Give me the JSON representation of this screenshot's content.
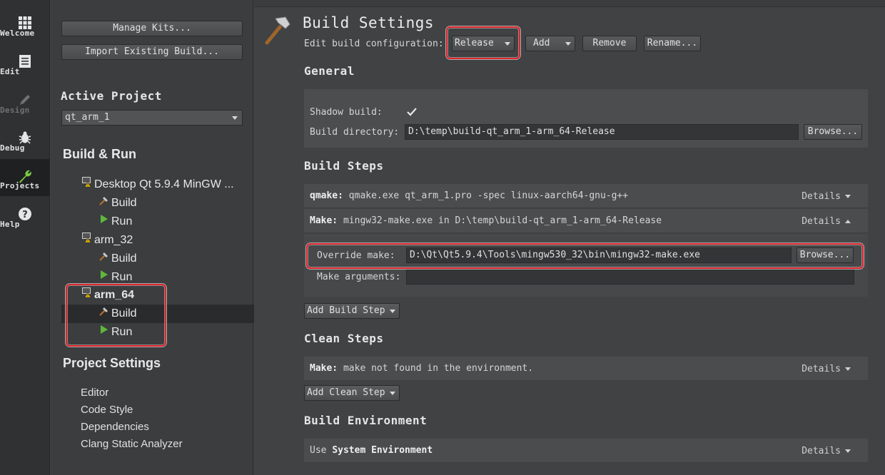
{
  "modebar": {
    "items": [
      {
        "label": "Welcome",
        "icon": "grid-icon"
      },
      {
        "label": "Edit",
        "icon": "document-icon"
      },
      {
        "label": "Design",
        "icon": "pencil-icon"
      },
      {
        "label": "Debug",
        "icon": "bug-icon"
      },
      {
        "label": "Projects",
        "icon": "wrench-icon"
      },
      {
        "label": "Help",
        "icon": "help-icon"
      }
    ]
  },
  "sidebar": {
    "manage_kits": "Manage Kits...",
    "import_build": "Import Existing Build...",
    "active_project_title": "Active Project",
    "active_project_value": "qt_arm_1",
    "build_run_title": "Build & Run",
    "kits": [
      {
        "name": "Desktop Qt 5.9.4 MinGW ...",
        "build": "Build",
        "run": "Run"
      },
      {
        "name": "arm_32",
        "build": "Build",
        "run": "Run"
      },
      {
        "name": "arm_64",
        "build": "Build",
        "run": "Run"
      }
    ],
    "project_settings_title": "Project Settings",
    "project_settings": [
      "Editor",
      "Code Style",
      "Dependencies",
      "Clang Static Analyzer"
    ]
  },
  "main": {
    "title": "Build Settings",
    "edit_config_label": "Edit build configuration:",
    "config_value": "Release",
    "add_label": "Add",
    "remove_label": "Remove",
    "rename_label": "Rename...",
    "general": {
      "title": "General",
      "shadow_build_label": "Shadow build:",
      "shadow_build_checked": true,
      "build_dir_label": "Build directory:",
      "build_dir_value": "D:\\temp\\build-qt_arm_1-arm_64-Release",
      "browse_label": "Browse..."
    },
    "build_steps": {
      "title": "Build Steps",
      "qmake_key": "qmake:",
      "qmake_value": "qmake.exe qt_arm_1.pro -spec linux-aarch64-gnu-g++",
      "make_key": "Make:",
      "make_value": "mingw32-make.exe in D:\\temp\\build-qt_arm_1-arm_64-Release",
      "details_label": "Details",
      "override_make_label": "Override make:",
      "override_make_value": "D:\\Qt\\Qt5.9.4\\Tools\\mingw530_32\\bin\\mingw32-make.exe",
      "browse_label": "Browse...",
      "make_args_label": "Make arguments:",
      "make_args_value": "",
      "add_step_label": "Add Build Step"
    },
    "clean_steps": {
      "title": "Clean Steps",
      "make_key": "Make:",
      "make_value": "make not found in the environment.",
      "details_label": "Details",
      "add_step_label": "Add Clean Step"
    },
    "build_env": {
      "title": "Build Environment",
      "use_label": "Use",
      "env_value": "System Environment",
      "details_label": "Details"
    }
  },
  "colors": {
    "highlight": "#e0242b",
    "background": "#404244",
    "modebar": "#2f3133"
  }
}
